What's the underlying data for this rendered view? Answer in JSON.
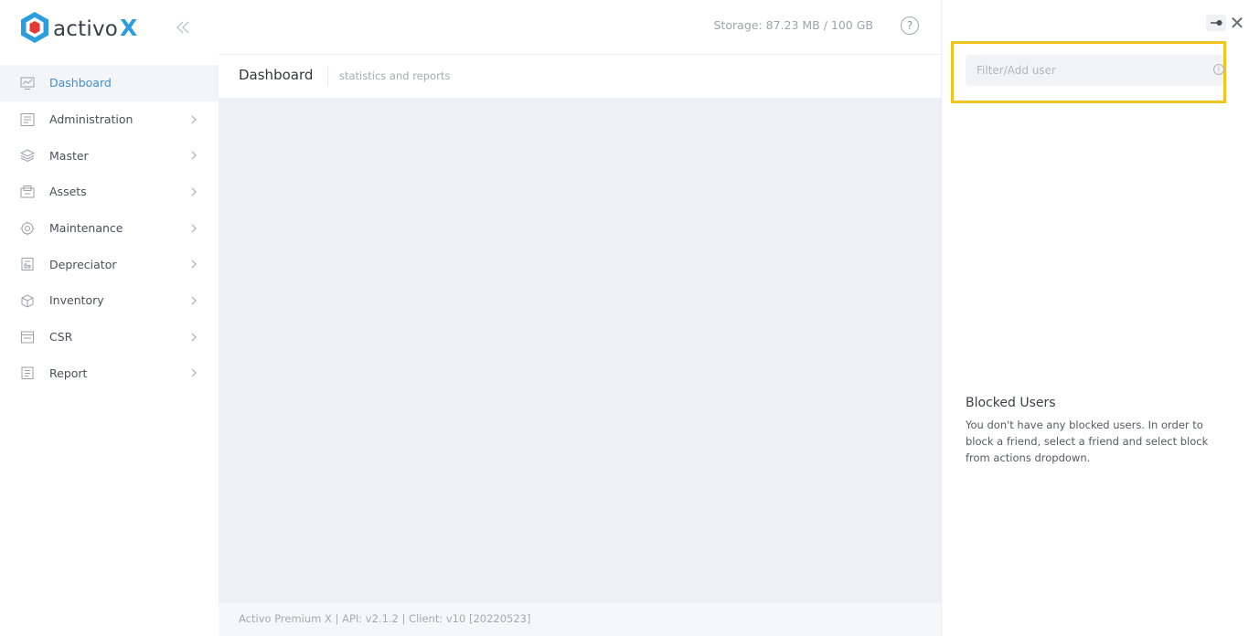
{
  "brand": {
    "name": "activo",
    "suffix": "X",
    "colors": {
      "hex_outer": "#2c9ee0",
      "hex_inner": "#e53935",
      "accent": "#3b8fd6"
    }
  },
  "sidebar": {
    "collapse_icon": "double-chevron-left-icon",
    "items": [
      {
        "label": "Dashboard",
        "icon": "dashboard-icon",
        "active": true,
        "has_children": false
      },
      {
        "label": "Administration",
        "icon": "administration-icon",
        "active": false,
        "has_children": true
      },
      {
        "label": "Master",
        "icon": "layers-icon",
        "active": false,
        "has_children": true
      },
      {
        "label": "Assets",
        "icon": "assets-icon",
        "active": false,
        "has_children": true
      },
      {
        "label": "Maintenance",
        "icon": "gear-icon",
        "active": false,
        "has_children": true
      },
      {
        "label": "Depreciator",
        "icon": "depreciator-icon",
        "active": false,
        "has_children": true
      },
      {
        "label": "Inventory",
        "icon": "inventory-icon",
        "active": false,
        "has_children": true
      },
      {
        "label": "CSR",
        "icon": "csr-icon",
        "active": false,
        "has_children": true
      },
      {
        "label": "Report",
        "icon": "report-icon",
        "active": false,
        "has_children": true
      }
    ]
  },
  "topbar": {
    "storage": "Storage: 87.23 MB / 100 GB",
    "help_icon": "help-icon",
    "help_glyph": "?"
  },
  "page": {
    "title": "Dashboard",
    "subtitle": "statistics and reports"
  },
  "footer": {
    "text": "Activo Premium X | API: v2.1.2 | Client: v10 [20220523]"
  },
  "panel": {
    "pin_icon": "pin-icon",
    "close_icon": "close-icon",
    "close_glyph": "✕",
    "search": {
      "placeholder": "Filter/Add user",
      "value": ""
    },
    "info_glyph": "i",
    "blocked": {
      "title": "Blocked Users",
      "description": "You don't have any blocked users. In order to block a friend, select a friend and select block from actions dropdown."
    }
  }
}
